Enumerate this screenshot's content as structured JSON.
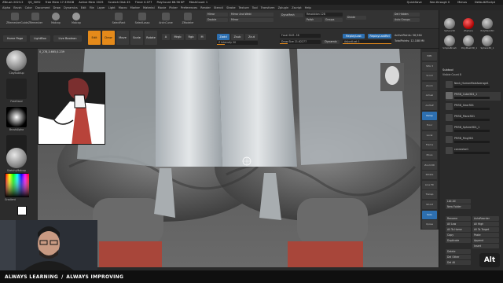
{
  "titlebar": {
    "items": [
      "ZBrush 2023.2",
      "QS_3092",
      "Free Mem 17.335GB",
      "Active Mem 2025",
      "Scratch Disk 45",
      "Timer 0.077",
      "PolyCount 66.56 KP",
      "MeshCount 1"
    ],
    "right": [
      "QuickSave",
      "See-through 0",
      "Menus",
      "DefaultZScript"
    ]
  },
  "menubar": [
    "Alpha",
    "Brush",
    "Color",
    "Document",
    "Draw",
    "Dynamics",
    "Edit",
    "File",
    "Layer",
    "Light",
    "Macro",
    "Marker",
    "Material",
    "Movie",
    "Picker",
    "Preferences",
    "Render",
    "Stencil",
    "Stroke",
    "Texture",
    "Tool",
    "Transform",
    "Zplugin",
    "Zscript",
    "Help"
  ],
  "shelf": {
    "buttons": [
      "ZRemesherGuide",
      "ZRemesher",
      "Matcap",
      "SelectRect",
      "SelectLasso",
      "ArcInCurve",
      "ZModeler"
    ],
    "dynamesh": "DynaMesh",
    "polish": "Polish",
    "groups": "Groups",
    "resolution": "Resolution 128",
    "mirror": "Mirror",
    "mirror_weld": "Mirror And Weld",
    "double": "Double",
    "divide": "Divide",
    "del_hidden": "Del Hidden",
    "auto_groups": "Auto Groups"
  },
  "toolbar2": {
    "home_page": "Home Page",
    "lightbox": "LightBox",
    "live_boolean": "Live Boolean",
    "edit": "Edit",
    "draw": "Draw",
    "move": "Move",
    "scale": "Scale",
    "rotate": "Rotate",
    "a": "A",
    "mrgb": "Mrgb",
    "rgb": "Rgb",
    "m": "M",
    "zadd": "Zadd",
    "zsub": "Zsub",
    "zcut": "Zcut",
    "rgb_intensity": "Rgb Intensity",
    "z_intensity": "Z Intensity 20",
    "focal_shift": "Focal Shift -56",
    "draw_size": "Draw Size 21.62277",
    "dynamic": "Dynamic",
    "replay_last": "ReplayLast",
    "replay_last_rel": "ReplayLastRel",
    "active_points": "ActivePoints: 56,564",
    "total_points": "TotalPoints: 12.188 Mil",
    "adjust_last": "AdjustLast 1"
  },
  "leftpanel": {
    "brush": "ClayBuildup",
    "stroke": "FreeHand",
    "alpha": "BrushAlpha",
    "texture": "Texture Off",
    "material": "SketchyMatcap",
    "gradient": "Gradient"
  },
  "hud": "0_278,3.665,0.239",
  "rightpanel": {
    "tools": [
      "Sphere3D",
      "ZSphere",
      "PolyMesh3D",
      "SimpleBrush",
      "PolyMesh3D_1",
      "Sphere3D_1"
    ],
    "subtool_title": "Subtool",
    "visible_count": "Visible Count 8",
    "subtools": [
      "Neck_HumanMaleAverage1",
      "PM3D_Cube3D1_1",
      "PM3D_Gear3D1",
      "PM3D_Plane3D1",
      "PM3D_Sphere3D1_1",
      "PM3D_Ring3D1",
      "connector1"
    ],
    "buttons": [
      "List All",
      "New Folder",
      "Rename",
      "AutoReorder",
      "All Low",
      "All High",
      "All To Home",
      "All To Target",
      "Copy",
      "Paste",
      "Duplicate",
      "Append",
      "Insert",
      "Delete",
      "Del Other",
      "Del All"
    ]
  },
  "navstrip": [
    "BPR",
    "SPix 3",
    "Scroll",
    "Zoom",
    "Actual",
    "AAHalf",
    "Persp",
    "Floor",
    "Local",
    "Frame",
    "Move",
    "Zoom3D",
    "Rotate",
    "Line Fill",
    "Transp",
    "Ghost",
    "Solo",
    "Xpose"
  ],
  "banner": {
    "left": "ALWAYS LEARNING",
    "separator": "/",
    "right": "ALWAYS IMPROVING"
  },
  "alt_key": "Alt",
  "colors": {
    "accent": "#e58a1a",
    "blue": "#2d6fb0",
    "cloth": "#d8d8d8",
    "sculpt": "#6e6e6e",
    "red": "#a8463a"
  }
}
